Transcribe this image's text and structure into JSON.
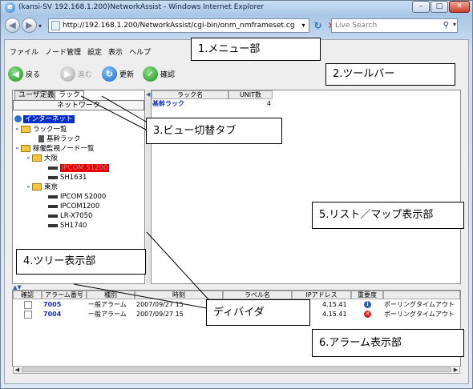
{
  "window": {
    "title": "(kansi-SV 192.168.1.200)NetworkAssist - Windows Internet Explorer",
    "controls": [
      "–",
      "□",
      "✕"
    ]
  },
  "browser": {
    "back_icon": "back-arrow-icon",
    "forward_icon": "forward-arrow-icon",
    "address": "http://192.168.1.200/NetworkAssist/cgi-bin/onm_nmframeset.cg",
    "search_placeholder": "Live Search"
  },
  "menu": [
    "ファイル",
    "ノード管理",
    "設定",
    "表示",
    "ヘルプ"
  ],
  "toolbar": {
    "back": "戻る",
    "forward": "進む",
    "refresh": "更新",
    "confirm": "確認"
  },
  "view_tabs": {
    "tab1": "ユーザ定義",
    "tab2": "ラック",
    "tab3": "ネットワーク"
  },
  "tree": {
    "root": "インターネット",
    "rack_list": "ラック一覧",
    "rack_main": "基幹ラック",
    "monitored": "稼働監視ノード一覧",
    "osaka": "大阪",
    "osaka_dev1": "IPCOM S1200",
    "osaka_dev2": "SH1631",
    "tokyo": "東京",
    "tokyo_dev1": "IPCOM S2000",
    "tokyo_dev2": "IPCOM1200",
    "tokyo_dev3": "LR-X7050",
    "tokyo_dev4": "SH1740"
  },
  "rack_list": {
    "columns": [
      "ラック名",
      "UNIT数"
    ],
    "rows": [
      {
        "name": "基幹ラック",
        "units": "4"
      }
    ]
  },
  "alarms": {
    "columns": [
      "確認",
      "アラーム番号",
      "種別",
      "時刻",
      "ラベル名",
      "IPアドレス",
      "重要度",
      ""
    ],
    "rows": [
      {
        "number": "7005",
        "type": "一般アラーム",
        "time": "2007/09/27 15",
        "ip": "4.15.41",
        "severity": "info",
        "message": "ポーリングタイムアウト"
      },
      {
        "number": "7004",
        "type": "一般アラーム",
        "time": "2007/09/27 15",
        "ip": "4.15.41",
        "severity": "critical",
        "message": "ポーリングタイムアウト"
      }
    ]
  },
  "annotations": {
    "a1": "1.メニュー部",
    "a2": "2.ツールバー",
    "a3": "3.ビュー切替タブ",
    "a4": "4.ツリー表示部",
    "a5": "5.リスト／マップ表示部",
    "a6": "6.アラーム表示部",
    "a7": "ディバイダ"
  }
}
